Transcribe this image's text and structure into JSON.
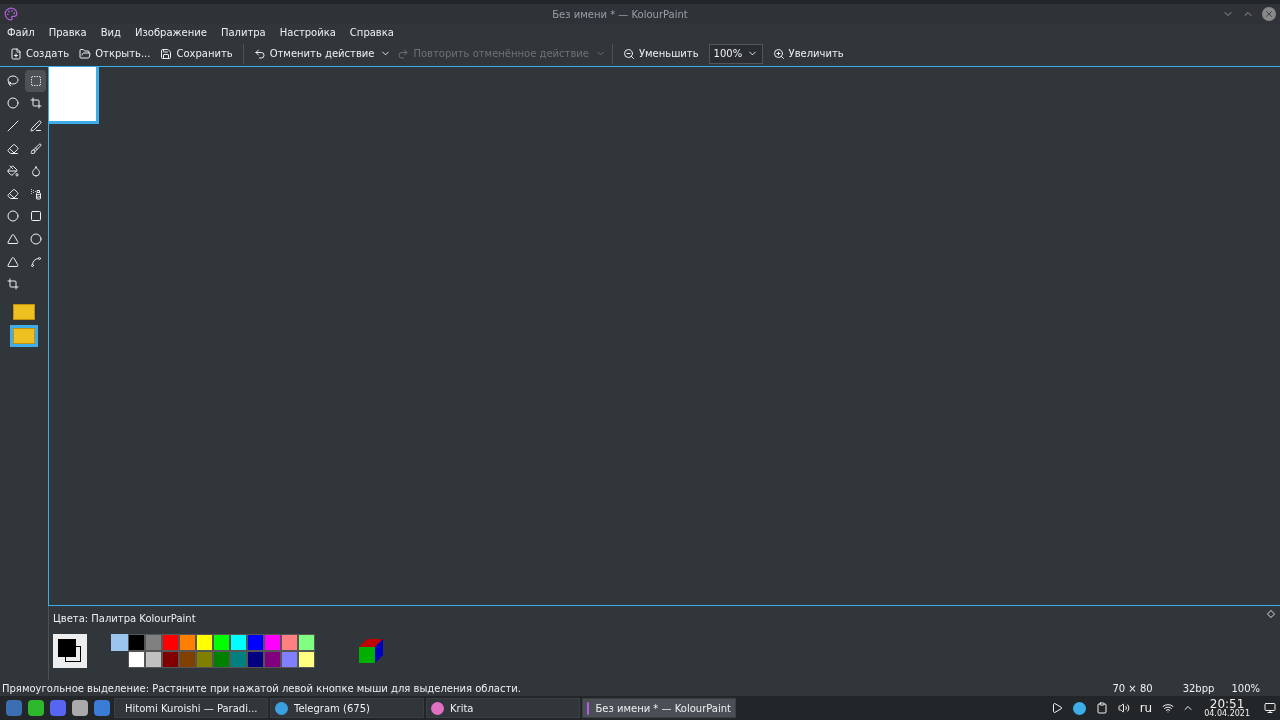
{
  "window": {
    "title": "Без имени * — KolourPaint"
  },
  "menu": [
    "Файл",
    "Правка",
    "Вид",
    "Изображение",
    "Палитра",
    "Настройка",
    "Справка"
  ],
  "toolbar": [
    {
      "kind": "new",
      "label": "Создать",
      "disabled": false
    },
    {
      "kind": "open",
      "label": "Открыть...",
      "disabled": false
    },
    {
      "kind": "save",
      "label": "Сохранить",
      "disabled": false
    },
    {
      "kind": "undo",
      "label": "Отменить действие",
      "disabled": false
    },
    {
      "kind": "redo",
      "label": "Повторить отменённое действие",
      "disabled": true
    },
    {
      "kind": "zoomout",
      "label": "Уменьшить",
      "disabled": false
    },
    {
      "kind": "zoom",
      "value": "100%"
    },
    {
      "kind": "zoomin",
      "label": "Увеличить",
      "disabled": false
    }
  ],
  "tools": [
    {
      "selected": false
    },
    {
      "selected": true
    },
    {
      "selected": false
    },
    {
      "selected": false
    },
    {
      "selected": false
    },
    {
      "selected": false
    },
    {
      "selected": false
    },
    {
      "selected": false
    },
    {
      "selected": false
    },
    {
      "selected": false
    },
    {
      "selected": false
    },
    {
      "selected": false
    },
    {
      "selected": false
    },
    {
      "selected": false
    },
    {
      "selected": false
    },
    {
      "selected": false
    },
    {
      "selected": false
    },
    {
      "selected": false
    },
    {
      "selected": false
    }
  ],
  "selection_modes": [
    {
      "selected": false
    },
    {
      "selected": true
    }
  ],
  "colors_panel": {
    "title": "Цвета: Палитра KolourPaint",
    "palette": [
      {
        "color": "#000000"
      },
      {
        "color": "#808080"
      },
      {
        "color": "#ff0000"
      },
      {
        "color": "#ff8000"
      },
      {
        "color": "#ffff00"
      },
      {
        "color": "#00ff00"
      },
      {
        "color": "#00ffff"
      },
      {
        "color": "#0000ff"
      },
      {
        "color": "#ff00ff"
      },
      {
        "color": "#ff8080"
      },
      {
        "color": "#80ff80"
      },
      {
        "color": "#ffffff"
      },
      {
        "color": "#c0c0c0"
      },
      {
        "color": "#800000"
      },
      {
        "color": "#804000"
      },
      {
        "color": "#808000"
      },
      {
        "color": "#008000"
      },
      {
        "color": "#008080"
      },
      {
        "color": "#000080"
      },
      {
        "color": "#800080"
      },
      {
        "color": "#8080ff"
      },
      {
        "color": "#ffff80"
      }
    ]
  },
  "status_bar": {
    "message": "Прямоугольное выделение: Растяните при нажатой левой кнопке мыши для выделения области.",
    "size": "70 × 80",
    "depth": "32bpp",
    "zoom": "100%"
  },
  "taskbar": {
    "tasks": [
      {
        "kind": "music",
        "label": "Hitomi Kuroishi — Paradi...",
        "selected": false
      },
      {
        "kind": "telegram",
        "label": "Telegram (675)",
        "selected": false
      },
      {
        "kind": "krita",
        "label": "Krita",
        "selected": false
      },
      {
        "kind": "kolourpaint",
        "label": "Без имени * — KolourPaint",
        "selected": true
      }
    ],
    "language": "ru",
    "time": "20:51",
    "date": "04.04.2021"
  }
}
